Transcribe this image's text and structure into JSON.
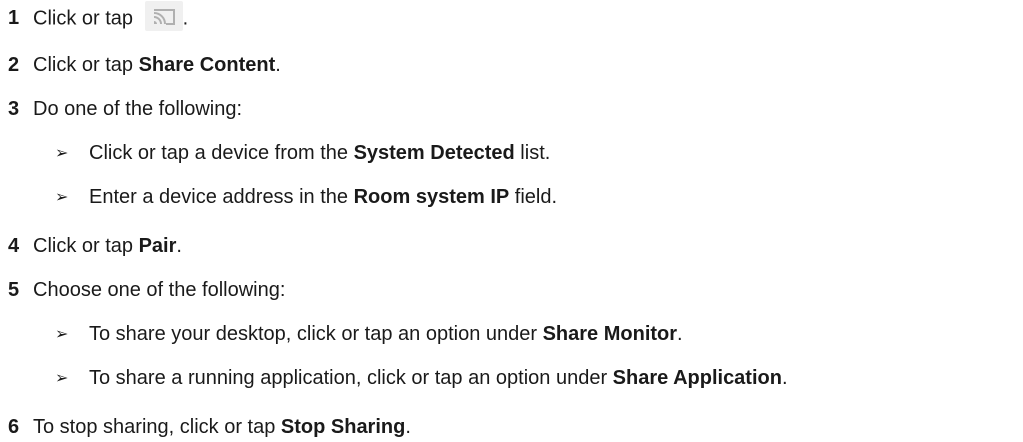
{
  "steps": [
    {
      "num": "1",
      "pre": "Click or tap ",
      "icon": "cast-icon",
      "post": "."
    },
    {
      "num": "2",
      "pre": "Click or tap ",
      "bold": "Share Content",
      "post": "."
    },
    {
      "num": "3",
      "text": "Do one of the following:"
    },
    {
      "num": "4",
      "pre": "Click or tap ",
      "bold": "Pair",
      "post": "."
    },
    {
      "num": "5",
      "text": "Choose one of the following:"
    },
    {
      "num": "6",
      "pre": "To stop sharing, click or tap ",
      "bold": "Stop Sharing",
      "post": "."
    }
  ],
  "step3_options": [
    {
      "pre": "Click or tap a device from the ",
      "bold": "System Detected",
      "post": " list."
    },
    {
      "pre": "Enter a device address in the ",
      "bold": "Room system IP",
      "post": " field."
    }
  ],
  "step5_options": [
    {
      "pre": "To share your desktop, click or tap an option under ",
      "bold": "Share Monitor",
      "post": "."
    },
    {
      "pre": "To share a running application, click or tap an option under ",
      "bold": "Share Application",
      "post": "."
    }
  ],
  "bullet_glyph": "➢"
}
